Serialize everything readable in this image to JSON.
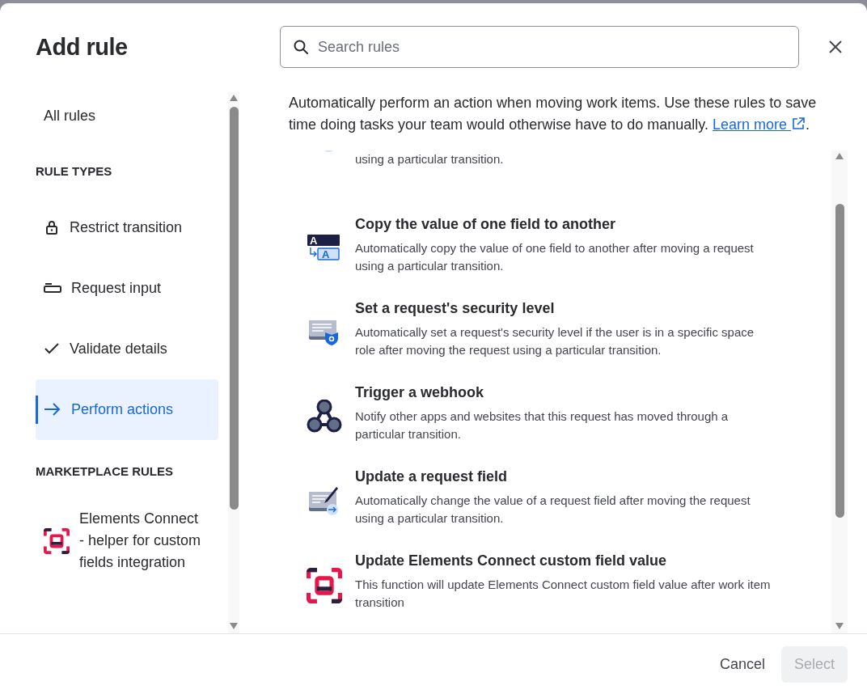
{
  "dialog": {
    "title": "Add rule",
    "search": {
      "placeholder": "Search rules"
    }
  },
  "sidebar": {
    "items": [
      {
        "kind": "link",
        "label": "All rules",
        "selected": false
      },
      {
        "kind": "heading",
        "label": "RULE TYPES"
      },
      {
        "kind": "item",
        "label": "Restrict transition",
        "selected": false
      },
      {
        "kind": "item",
        "label": "Request input",
        "selected": false
      },
      {
        "kind": "item",
        "label": "Validate details",
        "selected": false
      },
      {
        "kind": "item",
        "label": "Perform actions",
        "selected": true
      },
      {
        "kind": "heading",
        "label": "MARKETPLACE RULES"
      },
      {
        "kind": "item",
        "label": "Elements Connect - helper for custom fields integration",
        "selected": false
      }
    ]
  },
  "intro": {
    "text": "Automatically perform an action when moving work items. Use these rules to save time doing tasks your team would otherwise have to do manually.",
    "link": "Learn more",
    "after": "."
  },
  "rules": [
    {
      "description": "using a particular transition."
    },
    {
      "title": "Copy the value of one field to another",
      "description": "Automatically copy the value of one field to another after moving a request using a particular transition.",
      "icon_text": [
        "A",
        "A"
      ]
    },
    {
      "title": "Set a request's security level",
      "description": "Automatically set a request's security level if the user is in a specific space role after moving the request using a particular transition."
    },
    {
      "title": "Trigger a webhook",
      "description": "Notify other apps and websites that this request has moved through a particular transition."
    },
    {
      "title": "Update a request field",
      "description": "Automatically change the value of a request field after moving the request using a particular transition."
    },
    {
      "title": "Update Elements Connect custom field value",
      "description": "This function will update Elements Connect custom field value after work item transition"
    }
  ],
  "footer": {
    "buttons": [
      {
        "label": "Cancel",
        "disabled": false
      },
      {
        "label": "Select",
        "disabled": true
      }
    ]
  }
}
